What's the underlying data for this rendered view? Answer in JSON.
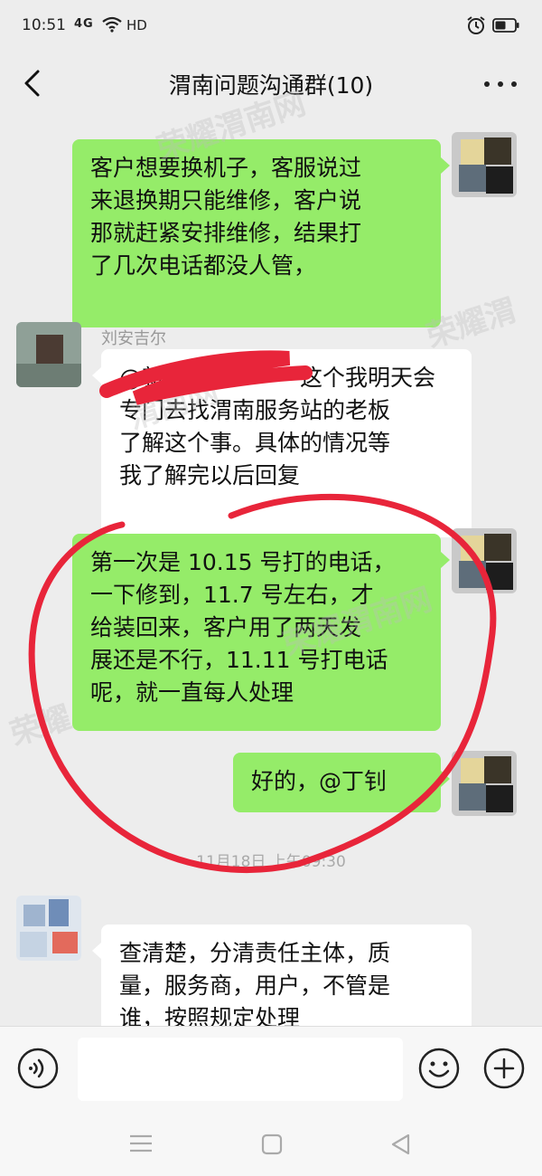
{
  "status_bar": {
    "time": "10:51",
    "network": "4G",
    "hd": "HD",
    "signal_icon": "signal-icon",
    "wifi_icon": "wifi-icon",
    "alarm_icon": "alarm-icon",
    "battery_icon": "battery-icon"
  },
  "header": {
    "title": "渭南问题沟通群(10)",
    "back_icon": "back-arrow-icon",
    "more_icon": "more-dots-icon"
  },
  "messages": [
    {
      "side": "right",
      "sender": "",
      "lines": [
        "客户想要换机子，客服说过",
        "来退换期只能维修，客户说",
        "那就赶紧安排维修，结果打",
        "了几次电话都没人管，"
      ]
    },
    {
      "side": "left",
      "sender": "刘安吉尔",
      "lines": [
        "@新　　　　　　这个我明天会",
        "专门去找渭南服务站的老板",
        "了解这个事。具体的情况等",
        "我了解完以后回复"
      ]
    },
    {
      "side": "right",
      "sender": "",
      "lines": [
        "第一次是 10.15 号打的电话，",
        "一下修到，11.7 号左右，才",
        "给装回来，客户用了两天发",
        "展还是不行，11.11 号打电话",
        "呢，就一直每人处理"
      ]
    },
    {
      "side": "right",
      "sender": "",
      "lines": [
        "好的，@丁钊"
      ]
    },
    {
      "side": "left",
      "sender": "",
      "lines": [
        "查清楚，分清责任主体，质",
        "量，服务商，用户，不管是",
        "谁，按照规定处理"
      ]
    }
  ],
  "timestamp": "11月18日 上午09:30",
  "watermarks": [
    "荣耀渭南网",
    "荣耀渭",
    "渭南网",
    "荣耀渭南网",
    "荣耀",
    "荣耀渭南网"
  ],
  "input": {
    "placeholder": "",
    "voice_icon": "voice-icon",
    "emoji_icon": "emoji-icon",
    "plus_icon": "plus-icon"
  },
  "nav": {
    "menu_icon": "menu-icon",
    "home_icon": "home-icon",
    "back_icon": "back-triangle-icon"
  },
  "colors": {
    "background": "#ededed",
    "bubble_green": "#95ec69",
    "bubble_white": "#ffffff",
    "annotation_red": "#e8253a"
  }
}
